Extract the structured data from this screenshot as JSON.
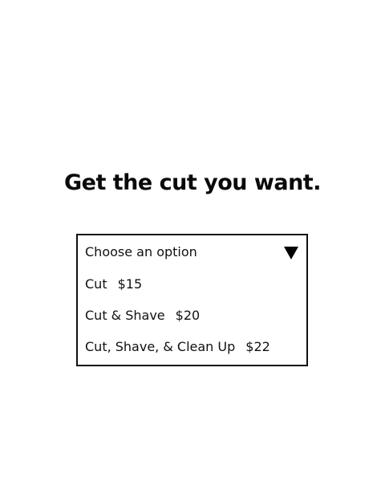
{
  "headline": "Get the cut you want.",
  "select": {
    "placeholder": "Choose an option",
    "arrow_icon": "triangle-down-icon",
    "options": [
      {
        "label": "Cut",
        "price": "$15"
      },
      {
        "label": "Cut & Shave",
        "price": "$20"
      },
      {
        "label": "Cut, Shave, & Clean Up",
        "price": "$22"
      }
    ]
  },
  "colors": {
    "background": "#ffffff",
    "text": "#111111",
    "border": "#111111"
  }
}
